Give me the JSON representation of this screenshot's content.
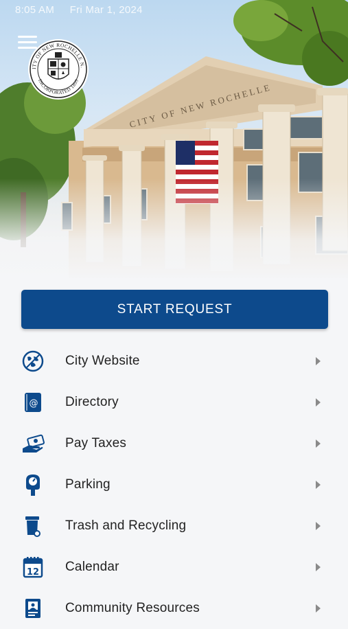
{
  "status_bar": {
    "time": "8:05 AM",
    "date": "Fri Mar 1, 2024"
  },
  "hero": {
    "building_inscription": "CITY OF NEW ROCHELLE",
    "seal_text_top": "CITY OF NEW ROCHELLE N.Y.",
    "seal_text_bottom": "INCORPORATED 1899"
  },
  "cta": {
    "label": "START REQUEST"
  },
  "menu": [
    {
      "label": "City Website",
      "icon": "globe-icon"
    },
    {
      "label": "Directory",
      "icon": "directory-icon"
    },
    {
      "label": "Pay Taxes",
      "icon": "pay-taxes-icon"
    },
    {
      "label": "Parking",
      "icon": "parking-meter-icon"
    },
    {
      "label": "Trash and Recycling",
      "icon": "trash-bin-icon"
    },
    {
      "label": "Calendar",
      "icon": "calendar-icon"
    },
    {
      "label": "Community Resources",
      "icon": "community-resources-icon"
    }
  ],
  "colors": {
    "accent": "#0d4a8c",
    "icon": "#0d4a8c",
    "background": "#f5f6f8"
  }
}
